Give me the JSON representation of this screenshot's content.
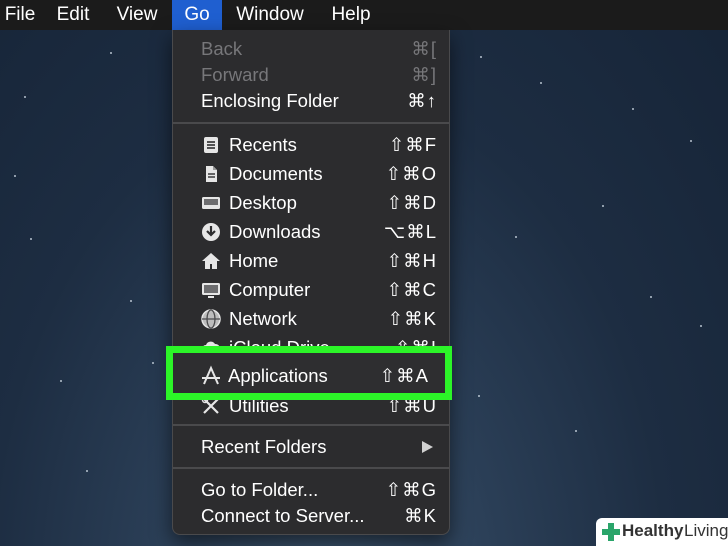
{
  "menubar": {
    "items": [
      "File",
      "Edit",
      "View",
      "Go",
      "Window",
      "Help"
    ],
    "active": "Go"
  },
  "menu": {
    "nav": [
      {
        "label": "Back",
        "shortcut": "⌘[",
        "enabled": false
      },
      {
        "label": "Forward",
        "shortcut": "⌘]",
        "enabled": false
      },
      {
        "label": "Enclosing Folder",
        "shortcut": "⌘↑",
        "enabled": true
      }
    ],
    "places": [
      {
        "label": "Recents",
        "shortcut": "⇧⌘F",
        "icon": "recents-icon"
      },
      {
        "label": "Documents",
        "shortcut": "⇧⌘O",
        "icon": "documents-icon"
      },
      {
        "label": "Desktop",
        "shortcut": "⇧⌘D",
        "icon": "desktop-icon"
      },
      {
        "label": "Downloads",
        "shortcut": "⌥⌘L",
        "icon": "downloads-icon"
      },
      {
        "label": "Home",
        "shortcut": "⇧⌘H",
        "icon": "home-icon"
      },
      {
        "label": "Computer",
        "shortcut": "⇧⌘C",
        "icon": "computer-icon"
      },
      {
        "label": "Network",
        "shortcut": "⇧⌘K",
        "icon": "network-icon"
      },
      {
        "label": "iCloud Drive",
        "shortcut": "⇧⌘I",
        "icon": "icloud-icon"
      },
      {
        "label": "Applications",
        "shortcut": "⇧⌘A",
        "icon": "applications-icon",
        "highlighted": true
      },
      {
        "label": "Utilities",
        "shortcut": "⇧⌘U",
        "icon": "utilities-icon"
      }
    ],
    "recent_folders": {
      "label": "Recent Folders",
      "has_submenu": true
    },
    "footer": [
      {
        "label": "Go to Folder...",
        "shortcut": "⇧⌘G"
      },
      {
        "label": "Connect to Server...",
        "shortcut": "⌘K"
      }
    ]
  },
  "watermark": {
    "word1": "Healthy",
    "word2": "Living"
  },
  "colors": {
    "highlight_border": "#2cf528",
    "menubar_active": "#1f5fd0",
    "menu_bg": "#2c2c2e"
  }
}
